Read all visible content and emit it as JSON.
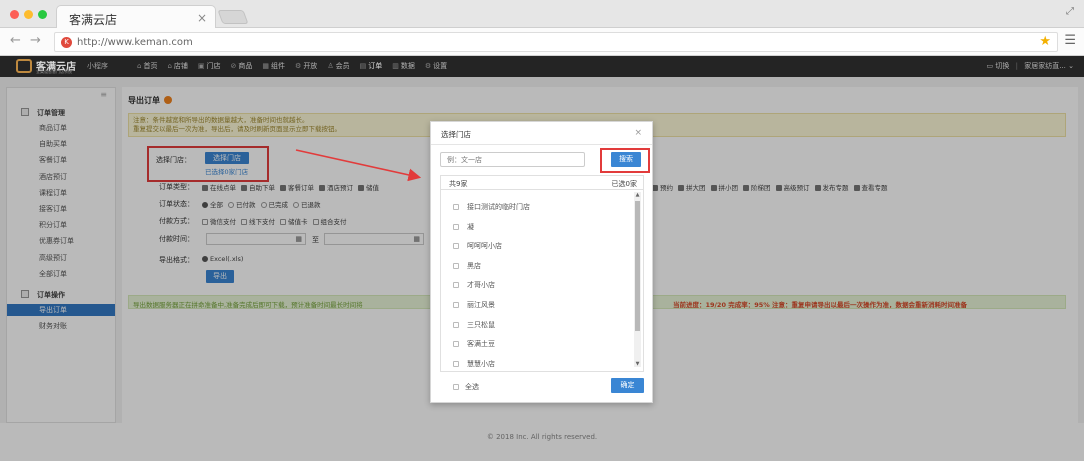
{
  "browser": {
    "tab_title": "客满云店",
    "tab_close": "×",
    "url": "http://www.keman.com",
    "site_icon_letter": "K"
  },
  "app": {
    "logo_text": "客满云店",
    "logo_sub": "全渠道智慧门店系统",
    "mini_program": "小程序",
    "nav": [
      {
        "label": "首页",
        "icon": "home-icon"
      },
      {
        "label": "店铺",
        "icon": "store-icon"
      },
      {
        "label": "门店",
        "icon": "shop-icon"
      },
      {
        "label": "商品",
        "icon": "tag-icon"
      },
      {
        "label": "组件",
        "icon": "grid-icon"
      },
      {
        "label": "开放",
        "icon": "gear-icon"
      },
      {
        "label": "会员",
        "icon": "user-icon"
      },
      {
        "label": "订单",
        "icon": "order-icon"
      },
      {
        "label": "数据",
        "icon": "chart-icon"
      },
      {
        "label": "设置",
        "icon": "settings-icon"
      }
    ],
    "nav_right_switch": "切换",
    "nav_right_user": "家居家纺直..."
  },
  "sidebar": {
    "group1": "订单管理",
    "group1_items": [
      "商品订单",
      "自助买单",
      "客餐订单",
      "酒店预订",
      "课程订单",
      "接客订单",
      "积分订单",
      "优惠券订单",
      "高级预订",
      "全部订单"
    ],
    "group2": "订单操作",
    "group2_items": [
      "导出订单",
      "财务对账"
    ],
    "active": "导出订单"
  },
  "main": {
    "title": "导出订单",
    "notice_line1": "注意：条件越宽和所导出的数据量越大，准备时间也就越长。",
    "notice_line2": "重复提交以最后一次为准，导出后，请及时刷新页面显示立即下载按钮。",
    "store_label": "选择门店：",
    "store_button": "选择门店",
    "store_selected": "已选择0家门店",
    "order_type_label": "订单类型：",
    "order_types_left": [
      "在线点单",
      "自助下单",
      "客餐订单",
      "酒店预订",
      "储值"
    ],
    "order_types_right": [
      "预约",
      "拼大团",
      "拼小团",
      "阶梯团",
      "高级预订",
      "发布专题",
      "查看专题"
    ],
    "order_status_label": "订单状态：",
    "order_statuses": [
      "全部",
      "已付款",
      "已完成",
      "已退款"
    ],
    "payment_label": "付款方式：",
    "payments": [
      "微信支付",
      "线下支付",
      "储值卡",
      "组合支付"
    ],
    "pay_time_label": "付款时间：",
    "date_to": "至",
    "export_format_label": "导出格式：",
    "export_format": "Excel(.xls)",
    "export_button": "导出",
    "progress_text": "导出数据服务器正在拼命准备中,准备完成后即可下载，预计准备时间最长时间将",
    "progress_warn": "当前进度：19/20 完成率：95% 注意：重复申请导出以最后一次操作为准，数据会重新消耗时间准备"
  },
  "footer": "© 2018 Inc. All rights reserved.",
  "modal": {
    "title": "选择门店",
    "close": "×",
    "search_placeholder": "例：文一店",
    "search_button": "搜索",
    "count_total": "共9家",
    "count_selected": "已选0家",
    "stores": [
      "接口测试的临时门店",
      "凝",
      "呵呵呵小店",
      "黑店",
      "才哥小店",
      "丽江风景",
      "三只松鼠",
      "客满土豆",
      "慧慧小店"
    ],
    "select_all": "全选",
    "confirm_button": "确定"
  },
  "colors": {
    "accent_blue": "#3a86d4",
    "highlight_red": "#e23b3b"
  }
}
